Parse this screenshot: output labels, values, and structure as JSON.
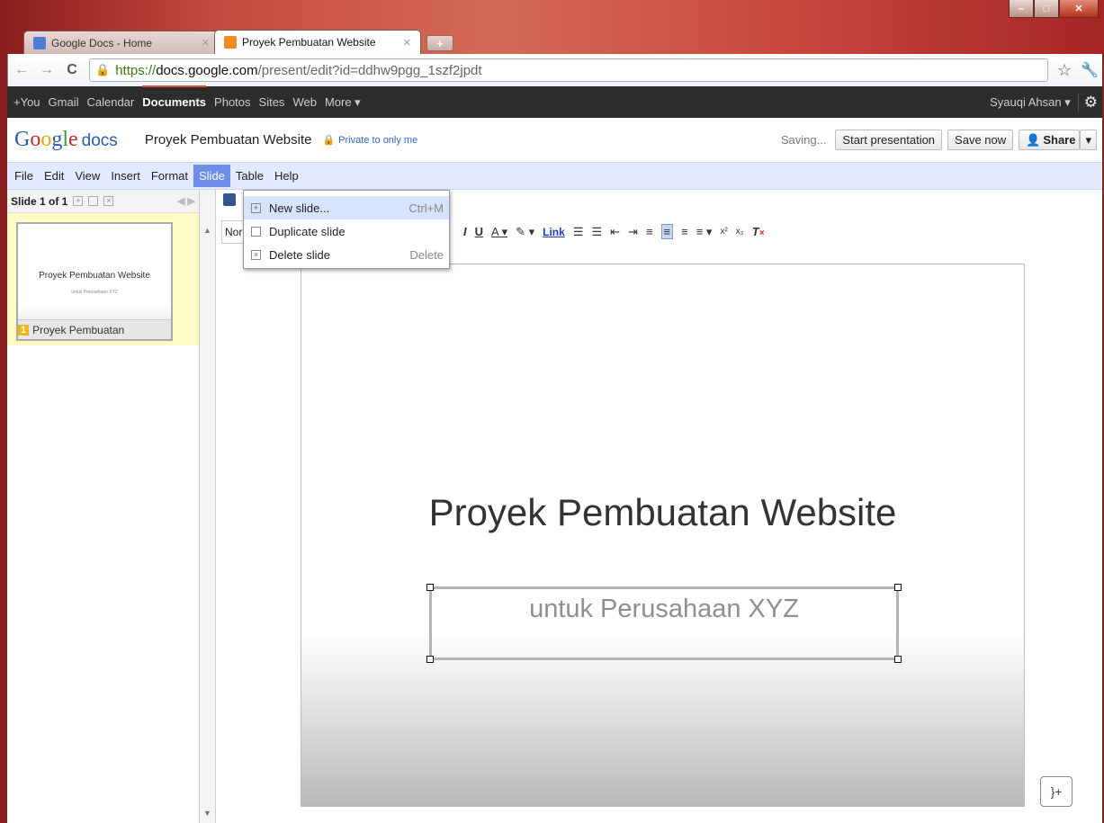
{
  "browser": {
    "tabs": [
      {
        "label": "Google Docs - Home",
        "active": false,
        "favicon_color": "#4a7fd6"
      },
      {
        "label": "Proyek Pembuatan Website",
        "active": true,
        "favicon_color": "#f08a24"
      }
    ],
    "url": {
      "scheme": "https://",
      "host": "docs.google.com",
      "path": "/present/edit?id=ddhw9pgg_1szf2jpdt"
    }
  },
  "gbar": {
    "items": [
      "+You",
      "Gmail",
      "Calendar",
      "Documents",
      "Photos",
      "Sites",
      "Web",
      "More ▾"
    ],
    "active": "Documents",
    "user": "Syauqi Ahsan ▾"
  },
  "docs_header": {
    "logo_docs": "docs",
    "title": "Proyek Pembuatan Website",
    "privacy": "Private to only me",
    "saving": "Saving...",
    "start_presentation": "Start presentation",
    "save_now": "Save now",
    "share": "Share"
  },
  "menubar": [
    "File",
    "Edit",
    "View",
    "Insert",
    "Format",
    "Slide",
    "Table",
    "Help"
  ],
  "slide_panel": {
    "counter": "Slide 1 of 1",
    "thumb_title": "Proyek Pembuatan Website",
    "thumb_subtitle": "untuk Perusahaan XYZ",
    "thumb_number": "1",
    "thumb_caption": "Proyek Pembuatan"
  },
  "toolbar": {
    "style_value": "Nor",
    "link_label": "Link"
  },
  "slide_menu": [
    {
      "label": "New slide...",
      "shortcut": "Ctrl+M",
      "icon": "plus-icon"
    },
    {
      "label": "Duplicate slide",
      "shortcut": "",
      "icon": "duplicate-icon"
    },
    {
      "label": "Delete slide",
      "shortcut": "Delete",
      "icon": "delete-icon"
    }
  ],
  "slide": {
    "title": "Proyek Pembuatan Website",
    "subtitle": "untuk Perusahaan XYZ"
  }
}
